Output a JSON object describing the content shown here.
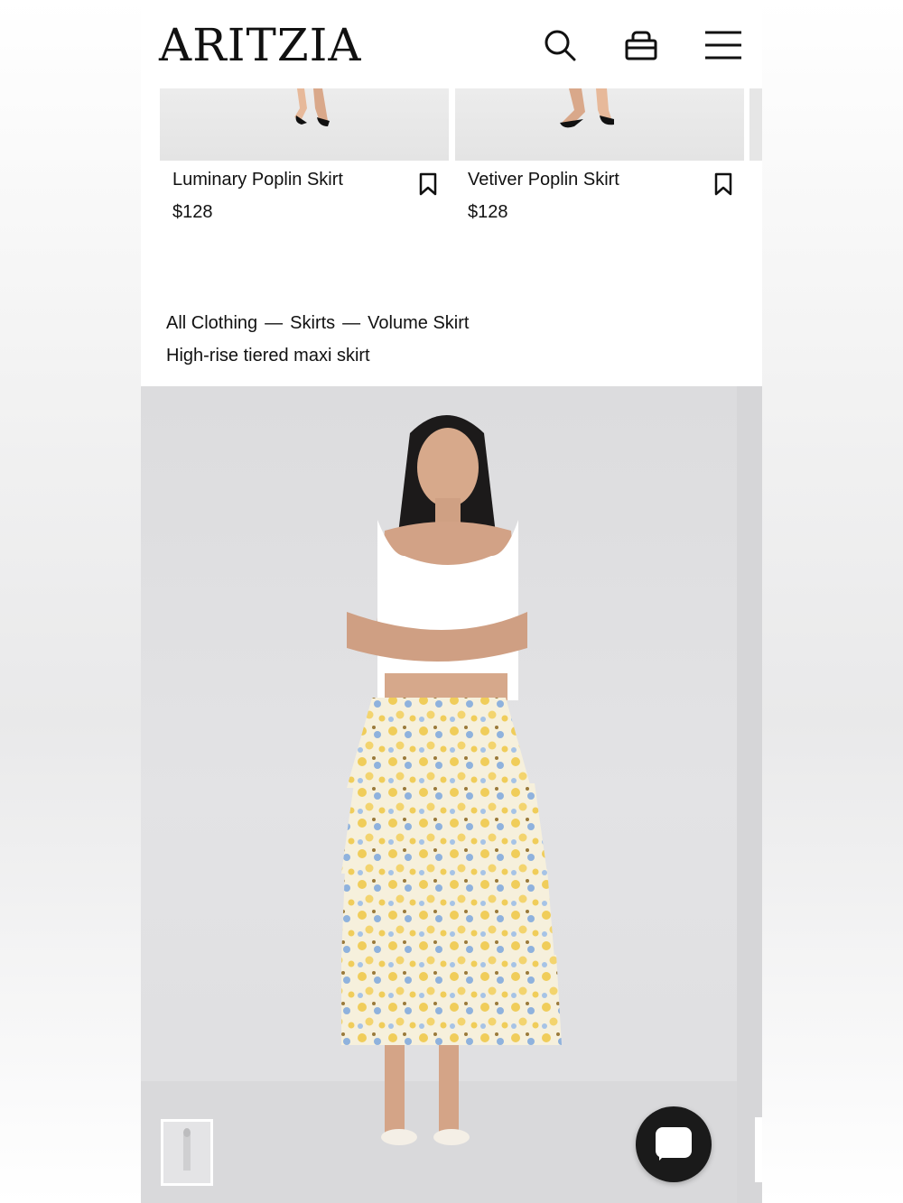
{
  "header": {
    "logo": "ARITZIA",
    "icons": [
      "search-icon",
      "bag-icon",
      "menu-icon"
    ]
  },
  "recommended": [
    {
      "name": "Luminary Poplin Skirt",
      "price": "$128"
    },
    {
      "name": "Vetiver Poplin Skirt",
      "price": "$128"
    }
  ],
  "breadcrumb": {
    "items": [
      "All Clothing",
      "Skirts",
      "Volume Skirt"
    ],
    "separator": "—"
  },
  "product": {
    "subtitle": "High-rise tiered maxi skirt"
  },
  "colors": {
    "background": "#ffffff",
    "text": "#111111",
    "chat_button": "#1a1a1a",
    "hero_bg": "#e0e0e2",
    "skirt_yellow": "#f0cd5a",
    "skirt_blue": "#8fb2dd"
  }
}
